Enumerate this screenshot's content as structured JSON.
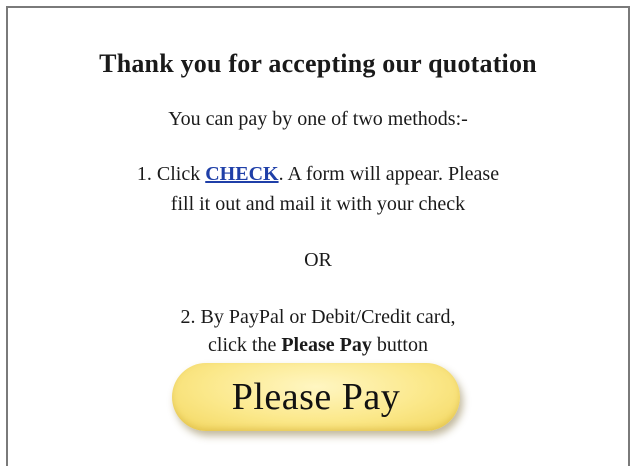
{
  "title": "Thank you for accepting our quotation",
  "intro": "You can pay by one of two methods:-",
  "option1": {
    "prefix": "1. Click ",
    "link_label": "CHECK",
    "suffix": ".  A form will appear. Please",
    "line2": "fill it out and mail it with your check"
  },
  "separator": "OR",
  "option2": {
    "line1": "2. By PayPal or Debit/Credit card,",
    "line2_prefix": "click the ",
    "line2_bold": "Please Pay",
    "line2_suffix": " button"
  },
  "pay_button": {
    "label": "Please Pay",
    "color": "#fbe88a"
  },
  "colors": {
    "link": "#1f3fa8",
    "frame_border": "#7a7a7a"
  }
}
